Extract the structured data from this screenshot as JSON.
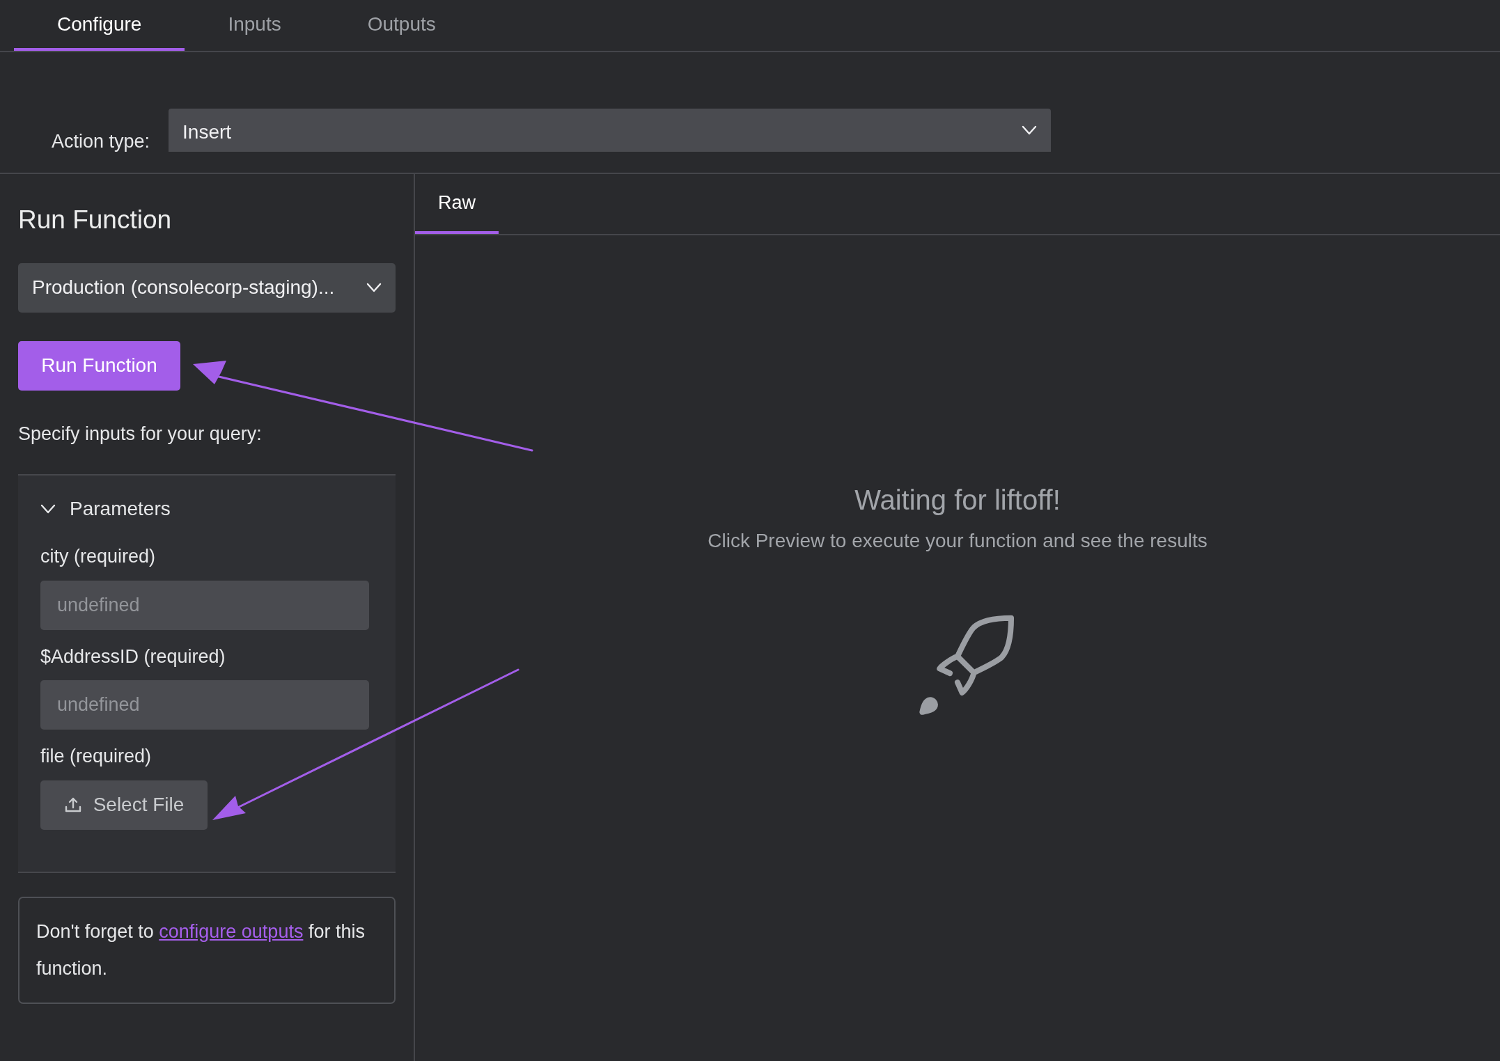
{
  "tabs": [
    {
      "label": "Configure",
      "selected": true
    },
    {
      "label": "Inputs",
      "selected": false
    },
    {
      "label": "Outputs",
      "selected": false
    }
  ],
  "action_type": {
    "label": "Action type:",
    "value": "Insert"
  },
  "run_panel": {
    "title": "Run Function",
    "environment": "Production (consolecorp-staging)...",
    "run_button": "Run Function",
    "inputs_prompt": "Specify inputs for your query:",
    "parameters": {
      "title": "Parameters",
      "expanded": true,
      "fields": [
        {
          "kind": "text",
          "label": "city (required)",
          "placeholder": "undefined"
        },
        {
          "kind": "text",
          "label": "$AddressID (required)",
          "placeholder": "undefined"
        },
        {
          "kind": "file",
          "label": "file (required)",
          "button": "Select File"
        }
      ]
    },
    "note": {
      "before": "Don't forget to",
      "link": "configure outputs",
      "after": "for this function."
    }
  },
  "results": {
    "tabs": [
      {
        "label": "Raw",
        "selected": true
      }
    ],
    "empty_title": "Waiting for liftoff!",
    "empty_message": "Click Preview to execute your function and see the results"
  }
}
